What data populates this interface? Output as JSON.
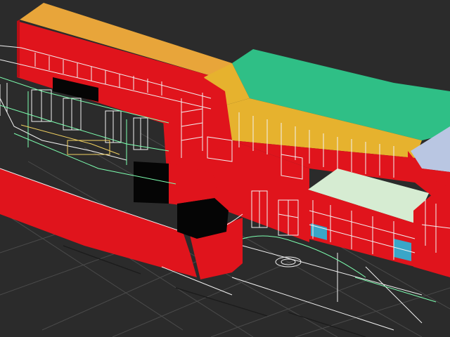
{
  "viewport": {
    "kind": "3D modeling viewport (perspective, wireframe over shaded)",
    "colors": {
      "background": "#2b2b2b",
      "grid": "#4a4a4a",
      "grid_major": "#1c1c1c",
      "red_object": "#e0141c",
      "red_shade": "#b50f16",
      "orange_roof": "#e8a53a",
      "yellow_roof": "#e6b22e",
      "green_roof": "#2fbf86",
      "pale_roof": "#d6ecd2",
      "blue_roof": "#b9c6e2",
      "wire_white": "#f2f2f2",
      "wire_green": "#7dffb0",
      "wire_yellow": "#f0d060",
      "wall_black": "#050505",
      "glass_cyan": "#3aa6c8"
    }
  }
}
